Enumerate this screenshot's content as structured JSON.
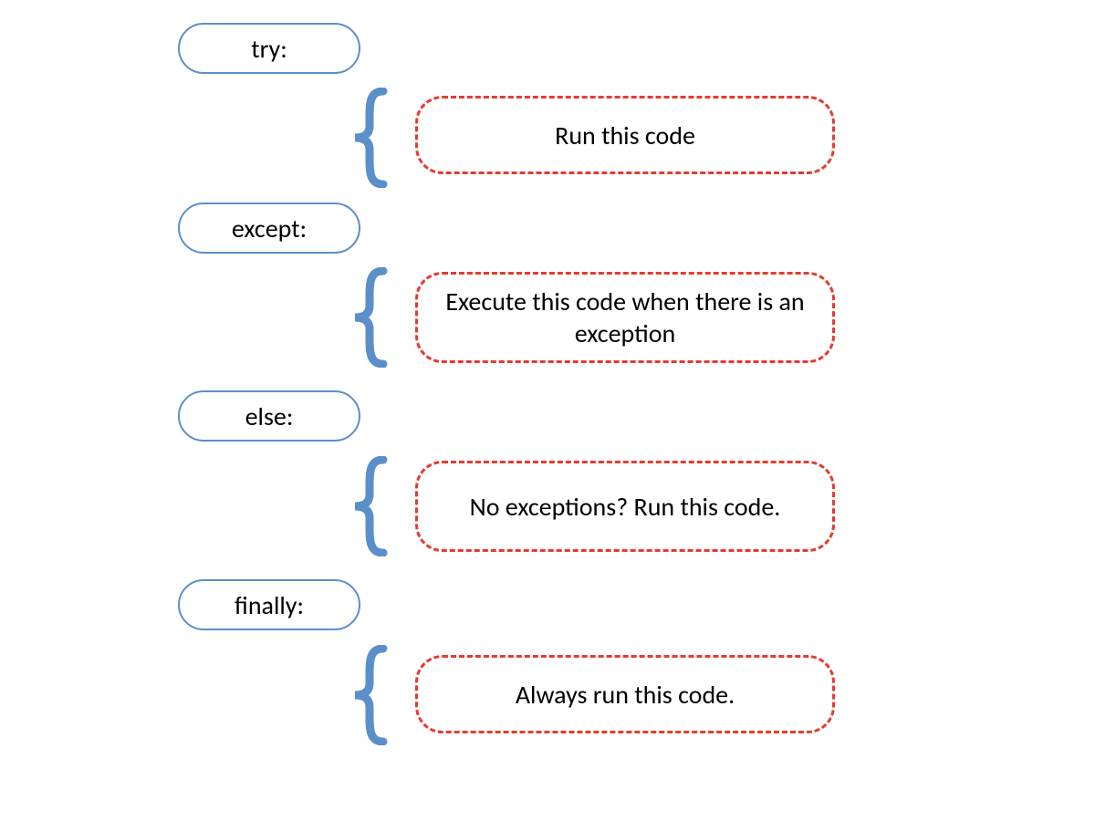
{
  "diagram": {
    "blocks": [
      {
        "keyword": "try:",
        "description": "Run this code"
      },
      {
        "keyword": "except:",
        "description": "Execute this code when there is an exception"
      },
      {
        "keyword": "else:",
        "description": "No exceptions? Run this code."
      },
      {
        "keyword": "finally:",
        "description": "Always run this code."
      }
    ]
  },
  "colors": {
    "pill_border": "#5b8fc9",
    "brace": "#5b8fc9",
    "desc_border": "#e63a2e"
  }
}
